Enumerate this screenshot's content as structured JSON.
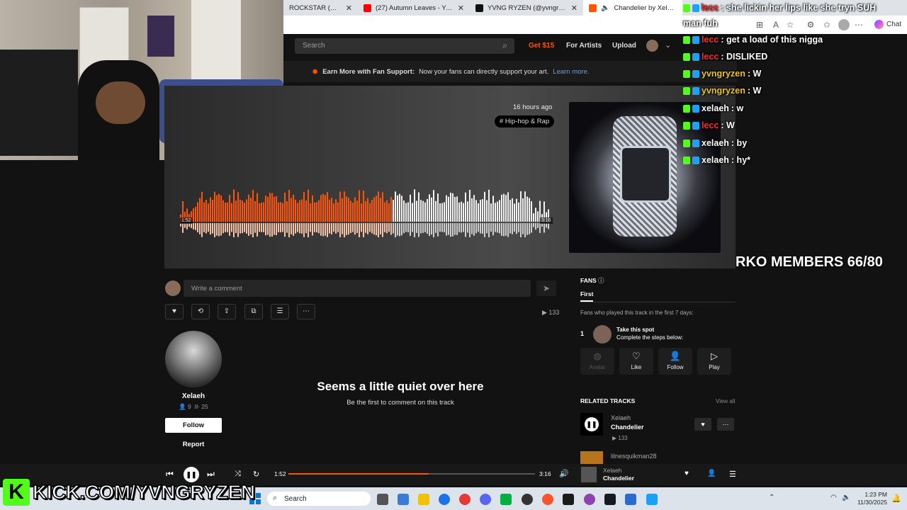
{
  "browser": {
    "tabs": [
      {
        "label": "ROCKSTAR (Official M",
        "favicon_color": "#2d6cdf"
      },
      {
        "label": "(27) Autumn Leaves - YouTube",
        "favicon_color": "#ff0000"
      },
      {
        "label": "YVNG RYZEN (@yvngryzen) | Tik",
        "favicon_color": "#111111"
      },
      {
        "label": "Chandelier by Xelaeh",
        "favicon_color": "#ff5500",
        "active": true
      }
    ],
    "chat_label": "Chat"
  },
  "soundcloud": {
    "search_placeholder": "Search",
    "header_links": {
      "get": "Get $15",
      "artists": "For Artists",
      "upload": "Upload"
    },
    "banner": {
      "bold": "Earn More with Fan Support:",
      "text": "Now your fans can directly support your art.",
      "link": "Learn more."
    },
    "track": {
      "posted": "16 hours ago",
      "genre": "# Hip-hop & Rap",
      "time_current_small": "1:52",
      "time_total_small": "3:16",
      "progress_fraction": 0.57
    },
    "comment_placeholder": "Write a comment",
    "play_count": "133",
    "artist": {
      "name": "Xelaeh",
      "followers": "9",
      "tracks": "25",
      "follow_label": "Follow",
      "report_label": "Report"
    },
    "empty_comments": {
      "title": "Seems a little quiet over here",
      "subtitle": "Be the first to comment on this track"
    },
    "fans": {
      "title": "FANS",
      "tab": "First",
      "description": "Fans who played this track in the first 7 days:",
      "rank": "1",
      "spot_title": "Take this spot",
      "spot_sub": "Complete the steps below:",
      "steps": [
        "Avatar",
        "Like",
        "Follow",
        "Play"
      ]
    },
    "related": {
      "title": "RELATED TRACKS",
      "view_all": "View all",
      "items": [
        {
          "artist": "Xelaeh",
          "track": "Chandelier",
          "plays": "133"
        },
        {
          "artist": "lilnesquikman28",
          "track": "",
          "plays": ""
        }
      ]
    },
    "player": {
      "current": "1:52",
      "total": "3:16",
      "now_artist": "Xelaeh",
      "now_track": "Chandelier"
    }
  },
  "stream_overlay": {
    "chat": [
      {
        "user": "lecc",
        "user_color": "#ff2a2a",
        "message": "she lickin her lips like she tryn SUH",
        "cont": "man fuh"
      },
      {
        "user": "lecc",
        "user_color": "#ff2a2a",
        "message": "get a load of this nigga"
      },
      {
        "user": "lecc",
        "user_color": "#ff2a2a",
        "message": "DISLIKED"
      },
      {
        "user": "yvngryzen",
        "user_color": "#f1c40f",
        "message": "W"
      },
      {
        "user": "yvngryzen",
        "user_color": "#f1c40f",
        "message": "W"
      },
      {
        "user": "xelaeh",
        "user_color": "#ffffff",
        "message": "w"
      },
      {
        "user": "lecc",
        "user_color": "#ff2a2a",
        "message": "W"
      },
      {
        "user": "xelaeh",
        "user_color": "#ffffff",
        "message": "by"
      },
      {
        "user": "xelaeh",
        "user_color": "#ffffff",
        "message": "hy*"
      }
    ],
    "members": "RKO MEMBERS 66/80",
    "kick_url": "KICK.COM/YVNGRYZEN"
  },
  "taskbar": {
    "search_label": "Search",
    "time": "1:23 PM",
    "date": "11/30/2025"
  },
  "colors": {
    "accent": "#ff5500",
    "kick_green": "#53fc18"
  }
}
